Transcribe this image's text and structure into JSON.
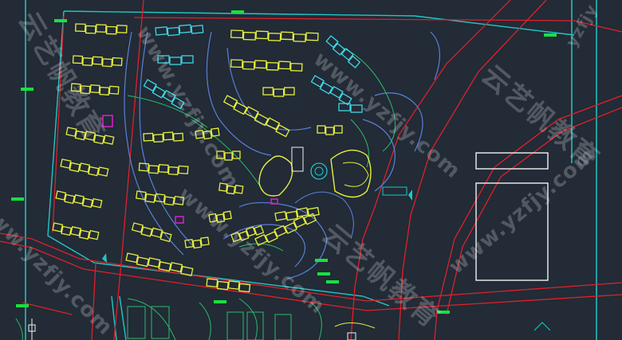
{
  "drawing": {
    "background": "#222b36",
    "colors": {
      "boundary": "#1fc7c7",
      "roads_red": "#e0202a",
      "buildings": "#e8ef3c",
      "buildings_alt": "#3fd6e6",
      "paths_blue": "#5b7fd8",
      "landscape_green": "#2fb86a",
      "labels_green": "#18e040",
      "accent_magenta": "#d020c8",
      "white": "#f2f2f2"
    }
  },
  "watermark": {
    "brand_cn": "云艺帆教育",
    "url": "www.yzfjy.com",
    "corner_url": "yzfjy"
  }
}
